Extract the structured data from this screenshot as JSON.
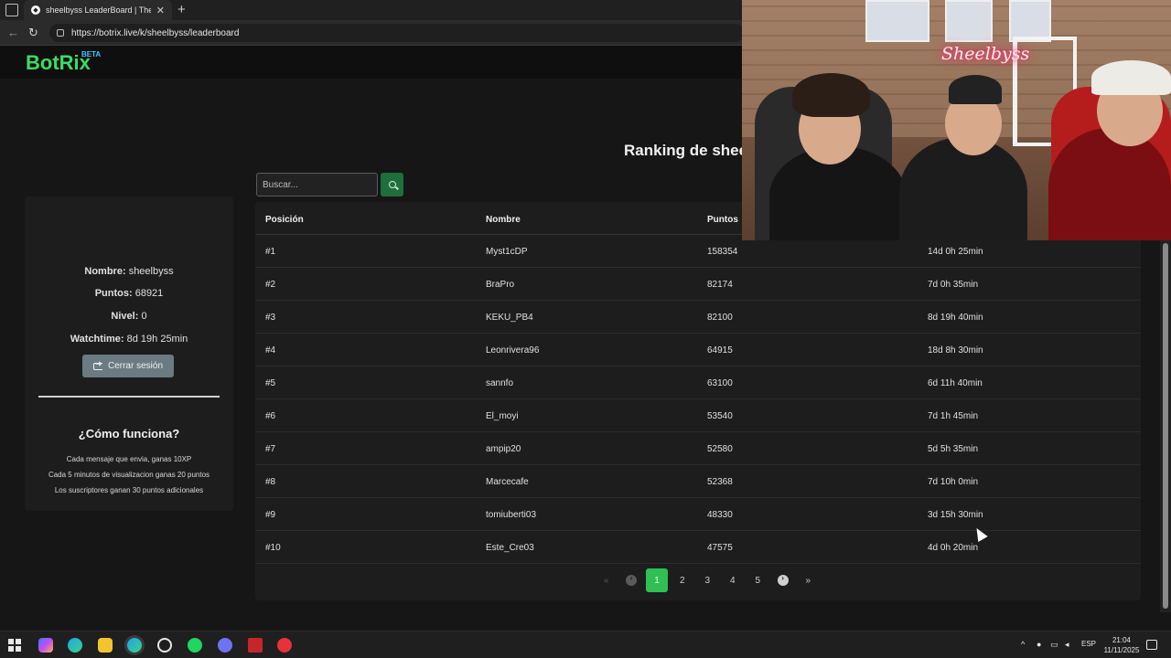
{
  "browser": {
    "tab_title": "sheelbyss LeaderBoard | The best",
    "tab_close": "✕",
    "new_tab": "+",
    "url": "https://botrix.live/k/sheelbyss/leaderboard",
    "back": "←",
    "reload": "↻"
  },
  "site": {
    "logo": "BotRix",
    "logo_badge": "BETA"
  },
  "header": {
    "ranking_title": "Ranking de sheel"
  },
  "search": {
    "placeholder": "Buscar..."
  },
  "profile": {
    "name_label": "Nombre:",
    "name_value": "sheelbyss",
    "points_label": "Puntos:",
    "points_value": "68921",
    "level_label": "Nivel:",
    "level_value": "0",
    "watchtime_label": "Watchtime:",
    "watchtime_value": "8d 19h 25min",
    "logout_label": "Cerrar sesión"
  },
  "how_it_works": {
    "title": "¿Cómo funciona?",
    "rules": [
      "Cada mensaje que envia, ganas 10XP",
      "Cada 5 minutos de visualizacion ganas 20 puntos",
      "Los suscriptores ganan 30 puntos adicionales"
    ]
  },
  "table": {
    "headers": [
      "Posición",
      "Nombre",
      "Puntos",
      ""
    ],
    "rows": [
      [
        "#1",
        "Myst1cDP",
        "158354",
        "14d 0h 25min"
      ],
      [
        "#2",
        "BraPro",
        "82174",
        "7d 0h 35min"
      ],
      [
        "#3",
        "KEKU_PB4",
        "82100",
        "8d 19h 40min"
      ],
      [
        "#4",
        "Leonrivera96",
        "64915",
        "18d 8h 30min"
      ],
      [
        "#5",
        "sannfo",
        "63100",
        "6d 11h 40min"
      ],
      [
        "#6",
        "El_moyi",
        "53540",
        "7d 1h 45min"
      ],
      [
        "#7",
        "ampip20",
        "52580",
        "5d 5h 35min"
      ],
      [
        "#8",
        "Marcecafe",
        "52368",
        "7d 10h 0min"
      ],
      [
        "#9",
        "tomiuberti03",
        "48330",
        "3d 15h 30min"
      ],
      [
        "#10",
        "Este_Cre03",
        "47575",
        "4d 0h 20min"
      ]
    ]
  },
  "pagination": {
    "first": "«",
    "pages": [
      "1",
      "2",
      "3",
      "4",
      "5"
    ],
    "last": "»",
    "current": "1"
  },
  "webcam": {
    "neon_sign": "Sheelbyss"
  },
  "taskbar": {
    "language": "ESP",
    "time": "21:04",
    "date": "11/11/2025"
  }
}
